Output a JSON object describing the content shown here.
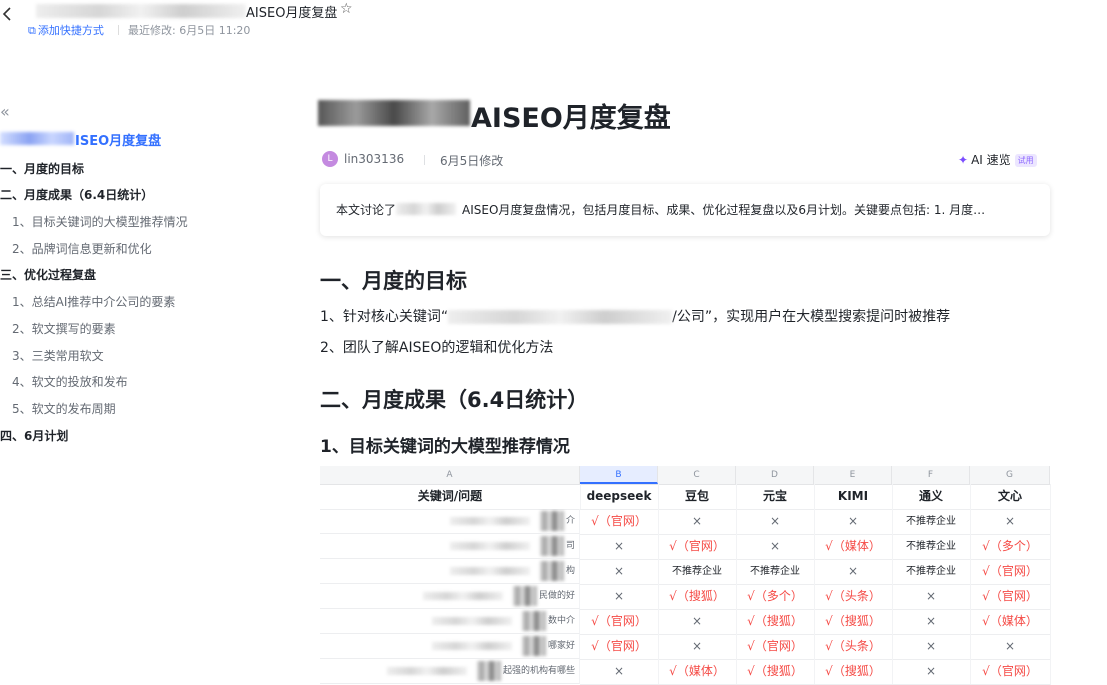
{
  "topbar": {
    "doc_title": "AISEO月度复盘",
    "add_shortcut": "添加快捷方式",
    "last_modified": "最近修改: 6月5日 11:20"
  },
  "sidebar": {
    "title": "ISEO月度复盘",
    "items": [
      {
        "label": "一、月度的目标",
        "level": 1
      },
      {
        "label": "二、月度成果（6.4日统计）",
        "level": 1
      },
      {
        "label": "1、目标关键词的大模型推荐情况",
        "level": 2
      },
      {
        "label": "2、品牌词信息更新和优化",
        "level": 2
      },
      {
        "label": "三、优化过程复盘",
        "level": 1
      },
      {
        "label": "1、总结AI推荐中介公司的要素",
        "level": 2
      },
      {
        "label": "2、软文撰写的要素",
        "level": 2
      },
      {
        "label": "3、三类常用软文",
        "level": 2
      },
      {
        "label": "4、软文的投放和发布",
        "level": 2
      },
      {
        "label": "5、软文的发布周期",
        "level": 2
      },
      {
        "label": "四、6月计划",
        "level": 1
      }
    ]
  },
  "doc": {
    "title": "AISEO月度复盘",
    "author": "lin303136",
    "avatar_letter": "L",
    "modified": "6月5日修改",
    "ai_label": "AI 速览",
    "ai_badge": "试用",
    "summary_pre": "本文讨论了",
    "summary_post": "AISEO月度复盘情况，包括月度目标、成果、优化过程复盘以及6月计划。关键要点包括: 1. 月度…",
    "h1_goal": "一、月度的目标",
    "goal_1_pre": "1、针对核心关键词“",
    "goal_1_post": "/公司”，实现用户在大模型搜索提问时被推荐",
    "goal_2": "2、团队了解AISEO的逻辑和优化方法",
    "h1_results": "二、月度成果（6.4日统计）",
    "h2_keywords": "1、目标关键词的大模型推荐情况"
  },
  "table": {
    "col_letters": [
      "A",
      "B",
      "C",
      "D",
      "E",
      "F",
      "G"
    ],
    "headers": [
      "关键词/问题",
      "deepseek",
      "豆包",
      "元宝",
      "KIMI",
      "通义",
      "文心"
    ],
    "rows": [
      {
        "kw": "介",
        "cells": [
          "√（官网）",
          "×",
          "×",
          "×",
          "不推荐企业",
          "×"
        ]
      },
      {
        "kw": "司",
        "cells": [
          "×",
          "√（官网）",
          "×",
          "√（媒体）",
          "不推荐企业",
          "√（多个）"
        ]
      },
      {
        "kw": "构",
        "cells": [
          "×",
          "不推荐企业",
          "不推荐企业",
          "×",
          "不推荐企业",
          "√（官网）"
        ]
      },
      {
        "kw": "民做的好",
        "cells": [
          "×",
          "√（搜狐）",
          "√（多个）",
          "√（头条）",
          "×",
          "√（官网）"
        ]
      },
      {
        "kw": "数中介",
        "cells": [
          "√（官网）",
          "×",
          "√（搜狐）",
          "√（搜狐）",
          "×",
          "√（媒体）"
        ]
      },
      {
        "kw": "哪家好",
        "cells": [
          "√（官网）",
          "×",
          "√（官网）",
          "√（头条）",
          "×",
          "×"
        ]
      },
      {
        "kw": "起强的机构有哪些",
        "cells": [
          "×",
          "√（媒体）",
          "√（搜狐）",
          "√（搜狐）",
          "×",
          "√（官网）"
        ]
      }
    ]
  }
}
